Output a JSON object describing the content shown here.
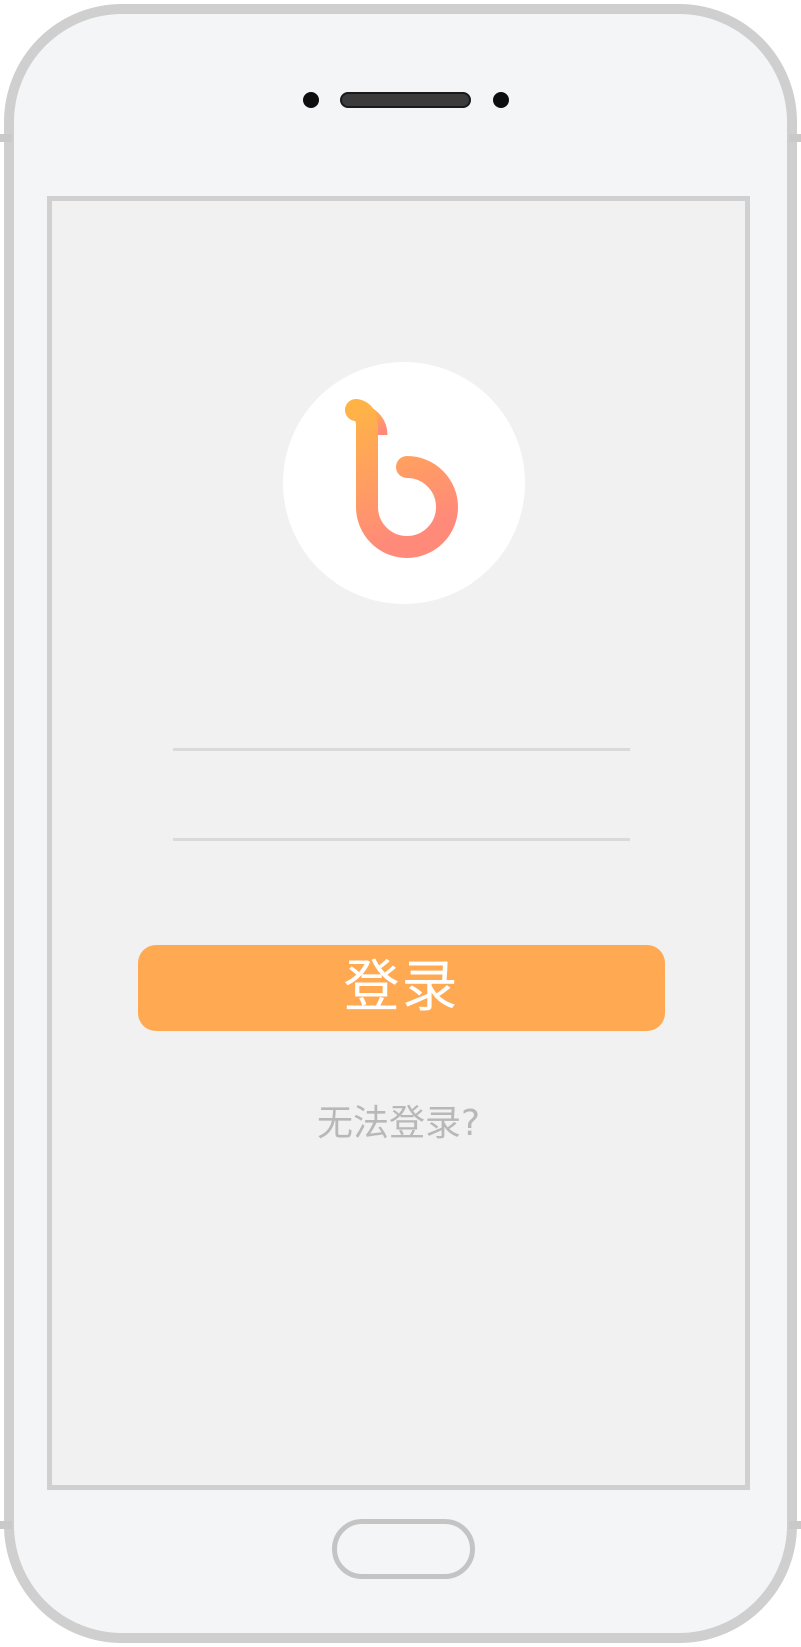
{
  "app": {
    "logo_name": "b-logo",
    "brand_gradient": [
      "#ffb347",
      "#ff8a7a"
    ]
  },
  "login": {
    "username_placeholder": "",
    "password_placeholder": "",
    "login_button_label": "登录",
    "help_link_label": "无法登录?"
  },
  "colors": {
    "accent": "#ffa953",
    "frame": "#cfcfcf",
    "screen_bg": "#f1f1f1",
    "help_text": "#b8b8b8"
  }
}
